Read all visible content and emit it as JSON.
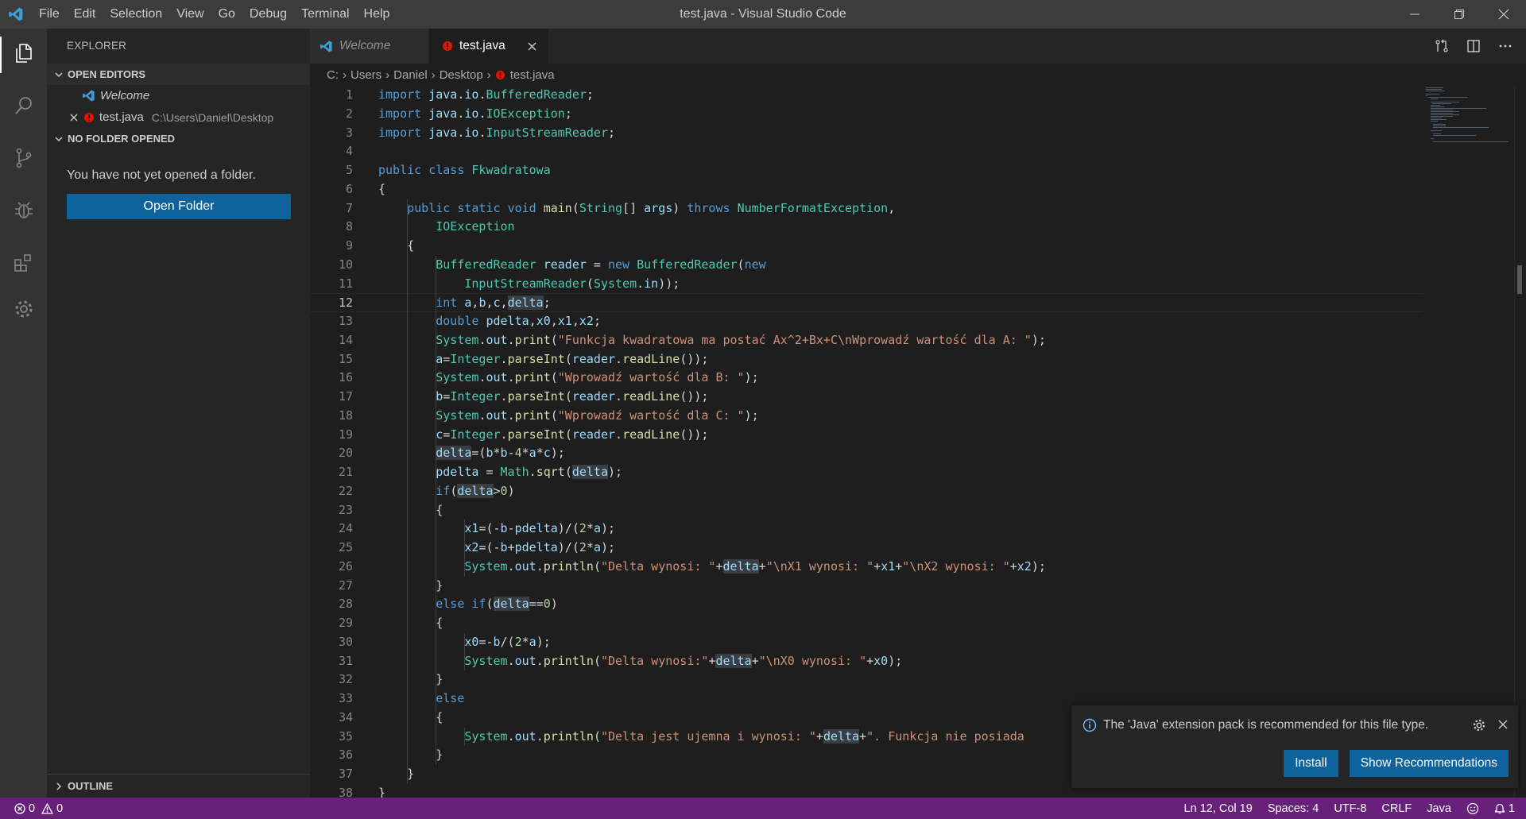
{
  "titlebar": {
    "title": "test.java - Visual Studio Code",
    "menu": [
      "File",
      "Edit",
      "Selection",
      "View",
      "Go",
      "Debug",
      "Terminal",
      "Help"
    ]
  },
  "sidebar": {
    "title": "EXPLORER",
    "open_editors": {
      "label": "OPEN EDITORS",
      "items": [
        {
          "name": "Welcome",
          "path": ""
        },
        {
          "name": "test.java",
          "path": "C:\\Users\\Daniel\\Desktop"
        }
      ]
    },
    "no_folder": {
      "label": "NO FOLDER OPENED",
      "message": "You have not yet opened a folder.",
      "button": "Open Folder"
    },
    "outline_label": "OUTLINE"
  },
  "tabs": [
    {
      "label": "Welcome",
      "active": false
    },
    {
      "label": "test.java",
      "active": true
    }
  ],
  "breadcrumb": [
    "C:",
    "Users",
    "Daniel",
    "Desktop",
    "test.java"
  ],
  "editor": {
    "cursor_line": 12,
    "lines": [
      "import java.io.BufferedReader;",
      "import java.io.IOException;",
      "import java.io.InputStreamReader;",
      "",
      "public class Fkwadratowa",
      "{",
      "    public static void main(String[] args) throws NumberFormatException,",
      "        IOException",
      "    {",
      "        BufferedReader reader = new BufferedReader(new",
      "            InputStreamReader(System.in));",
      "        int a,b,c,delta;",
      "        double pdelta,x0,x1,x2;",
      "        System.out.print(\"Funkcja kwadratowa ma postać Ax^2+Bx+C\\nWprowadź wartość dla A: \");",
      "        a=Integer.parseInt(reader.readLine());",
      "        System.out.print(\"Wprowadź wartość dla B: \");",
      "        b=Integer.parseInt(reader.readLine());",
      "        System.out.print(\"Wprowadź wartość dla C: \");",
      "        c=Integer.parseInt(reader.readLine());",
      "        delta=(b*b-4*a*c);",
      "        pdelta = Math.sqrt(delta);",
      "        if(delta>0)",
      "        {",
      "            x1=(-b-pdelta)/(2*a);",
      "            x2=(-b+pdelta)/(2*a);",
      "            System.out.println(\"Delta wynosi: \"+delta+\"\\nX1 wynosi: \"+x1+\"\\nX2 wynosi: \"+x2);",
      "        }",
      "        else if(delta==0)",
      "        {",
      "            x0=-b/(2*a);",
      "            System.out.println(\"Delta wynosi:\"+delta+\"\\nX0 wynosi: \"+x0);",
      "        }",
      "        else",
      "        {",
      "            System.out.println(\"Delta jest ujemna i wynosi: \"+delta+\". Funkcja nie posiada",
      "        }",
      "    }",
      "}"
    ]
  },
  "notification": {
    "message": "The 'Java' extension pack is recommended for this file type.",
    "install": "Install",
    "show": "Show Recommendations"
  },
  "statusbar": {
    "errors": "0",
    "warnings": "0",
    "position": "Ln 12, Col 19",
    "spaces": "Spaces: 4",
    "encoding": "UTF-8",
    "eol": "CRLF",
    "language": "Java",
    "notifications": "1"
  },
  "colors": {
    "accent_blue": "#0e639c",
    "statusbar": "#68217a",
    "error_icon": "#f14c4c"
  }
}
